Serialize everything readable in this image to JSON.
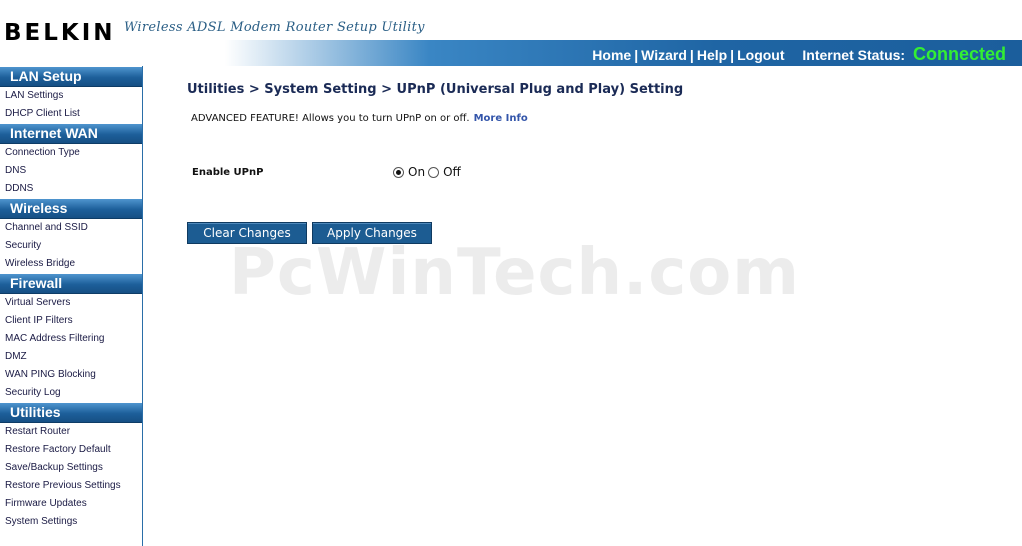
{
  "header": {
    "logo": "BELKIN",
    "tagline": "Wireless ADSL Modem Router Setup Utility",
    "nav": {
      "home": "Home",
      "wizard": "Wizard",
      "help": "Help",
      "logout": "Logout",
      "separator": "|"
    },
    "status_label": "Internet Status:",
    "status_value": "Connected"
  },
  "sidebar": {
    "sections": [
      {
        "title": "LAN Setup",
        "items": [
          "LAN Settings",
          "DHCP Client List"
        ]
      },
      {
        "title": "Internet WAN",
        "items": [
          "Connection Type",
          "DNS",
          "DDNS"
        ]
      },
      {
        "title": "Wireless",
        "items": [
          "Channel and SSID",
          "Security",
          "Wireless Bridge"
        ]
      },
      {
        "title": "Firewall",
        "items": [
          "Virtual Servers",
          "Client IP Filters",
          "MAC Address Filtering",
          "DMZ",
          "WAN PING Blocking",
          "Security Log"
        ]
      },
      {
        "title": "Utilities",
        "items": [
          "Restart Router",
          "Restore Factory Default",
          "Save/Backup Settings",
          "Restore Previous Settings",
          "Firmware Updates",
          "System Settings"
        ]
      }
    ]
  },
  "main": {
    "title": "Utilities > System Setting > UPnP (Universal Plug and Play) Setting",
    "intro": "ADVANCED FEATURE! Allows you to turn UPnP on or off.",
    "more_info": "More Info",
    "enable_label": "Enable UPnP",
    "options": {
      "on": "On",
      "off": "Off",
      "selected": "On"
    },
    "clear_button": "Clear Changes",
    "apply_button": "Apply Changes"
  },
  "watermark": "PcWinTech.com",
  "colors": {
    "accent": "#1c5c92",
    "status": "#33ee33",
    "title": "#1a2a55"
  }
}
